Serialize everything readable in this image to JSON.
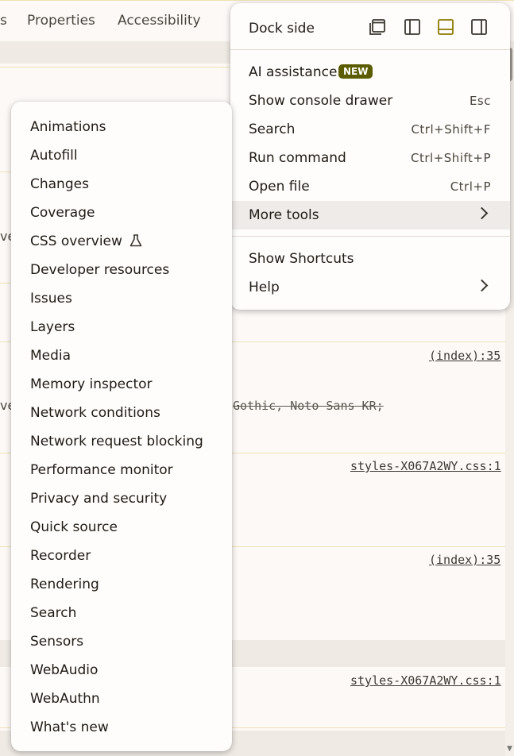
{
  "tabs": [
    "s",
    "Properties",
    "Accessibility"
  ],
  "edge_text": [
    "ve",
    "ve"
  ],
  "source_links": [
    "(index):35",
    "styles-X067A2WY.css:1",
    "(index):35",
    "styles-X067A2WY.css:1"
  ],
  "struck_text": "Gothic, Noto Sans KR;",
  "menu": {
    "dock_side_label": "Dock side",
    "dock_icons": [
      "undock-icon",
      "dock-left-icon",
      "dock-bottom-icon",
      "dock-right-icon"
    ],
    "dock_selected": "dock-bottom-icon",
    "items": [
      {
        "label": "AI assistance",
        "badge": "NEW"
      },
      {
        "label": "Show console drawer",
        "shortcut": "Esc"
      },
      {
        "label": "Search",
        "shortcut": "Ctrl+Shift+F"
      },
      {
        "label": "Run command",
        "shortcut": "Ctrl+Shift+P"
      },
      {
        "label": "Open file",
        "shortcut": "Ctrl+P"
      },
      {
        "label": "More tools"
      },
      {
        "label": "Show Shortcuts"
      },
      {
        "label": "Help"
      }
    ]
  },
  "more_tools": [
    "Animations",
    "Autofill",
    "Changes",
    "Coverage",
    "CSS overview",
    "Developer resources",
    "Issues",
    "Layers",
    "Media",
    "Memory inspector",
    "Network conditions",
    "Network request blocking",
    "Performance monitor",
    "Privacy and security",
    "Quick source",
    "Recorder",
    "Rendering",
    "Search",
    "Sensors",
    "WebAudio",
    "WebAuthn",
    "What's new"
  ],
  "colors": {
    "accent": "#5b5b00",
    "hover": "#efebe8",
    "divider": "#ece3b4"
  }
}
